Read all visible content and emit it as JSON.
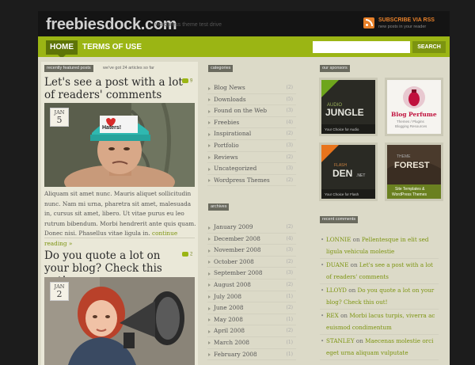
{
  "header": {
    "logo": "freebiesdock.com",
    "tagline": "wordpress theme test drive",
    "rss_title": "SUBSCRIBE VIA RSS",
    "rss_sub": "new posts in your reader"
  },
  "nav": {
    "home": "HOME",
    "terms": "TERMS OF USE",
    "search_placeholder": "",
    "search_button": "SEARCH"
  },
  "main": {
    "featured_badge": "recently featured posts",
    "articles_note": "we've got 24 articles so far",
    "posts": [
      {
        "title": "Let's see a post with a lot of readers' comments",
        "comments": "9",
        "month": "JAN",
        "day": "5",
        "hat_text": "Haters!",
        "excerpt": "Aliquam sit amet nunc. Mauris aliquet sollicitudin nunc. Nam mi urna, pharetra sit amet, malesuada in, cursus sit amet, libero. Ut vitae purus eu leo rutrum bibendum. Morbi hendrerit ante quis quam. Donec nisi. Phasellus vitae ligula in.",
        "continue": "continue reading »"
      },
      {
        "title": "Do you quote a lot on your blog? Check this out!",
        "comments": "2",
        "month": "JAN",
        "day": "2"
      }
    ]
  },
  "categories": {
    "badge": "categories",
    "items": [
      {
        "label": "Blog News",
        "count": "(2)"
      },
      {
        "label": "Downloads",
        "count": "(5)"
      },
      {
        "label": "Found on the Web",
        "count": "(3)"
      },
      {
        "label": "Freebies",
        "count": "(4)"
      },
      {
        "label": "Inspirational",
        "count": "(2)"
      },
      {
        "label": "Portfolio",
        "count": "(3)"
      },
      {
        "label": "Reviews",
        "count": "(2)"
      },
      {
        "label": "Uncategorized",
        "count": "(3)"
      },
      {
        "label": "Wordpress Themes",
        "count": "(2)"
      }
    ]
  },
  "archives": {
    "badge": "archives",
    "items": [
      {
        "label": "January 2009",
        "count": "(2)"
      },
      {
        "label": "December 2008",
        "count": "(4)"
      },
      {
        "label": "November 2008",
        "count": "(3)"
      },
      {
        "label": "October 2008",
        "count": "(2)"
      },
      {
        "label": "September 2008",
        "count": "(3)"
      },
      {
        "label": "August 2008",
        "count": "(2)"
      },
      {
        "label": "July 2008",
        "count": "(1)"
      },
      {
        "label": "June 2008",
        "count": "(2)"
      },
      {
        "label": "May 2008",
        "count": "(1)"
      },
      {
        "label": "April 2008",
        "count": "(2)"
      },
      {
        "label": "March 2008",
        "count": "(1)"
      },
      {
        "label": "February 2008",
        "count": "(1)"
      }
    ]
  },
  "sponsors": {
    "badge": "our sponsors",
    "items": [
      {
        "line1": "AUDIO",
        "line2": "JUNGLE",
        "tag": "Your Choice for Audio"
      },
      {
        "line1": "Blog Perfume",
        "line2": "Themes / Plugins",
        "tag": "Blogging Resources"
      },
      {
        "line1": "FLASH",
        "line2": "DEN",
        "line3": ".NET",
        "tag": "Your Choice for Flash"
      },
      {
        "line1": "THEME",
        "line2": "FOREST",
        "line3": "Site Templates &",
        "tag": "WordPress Themes"
      }
    ]
  },
  "recent_comments": {
    "badge": "recent comments",
    "items": [
      {
        "author": "LONNIE",
        "on": "on",
        "text": "Pellentesque in elit sed ligula vehicula molestie"
      },
      {
        "author": "DUANE",
        "on": "on",
        "text": "Let's see a post with a lot of readers' comments"
      },
      {
        "author": "LLOYD",
        "on": "on",
        "text": "Do you quote a lot on your blog? Check this out!"
      },
      {
        "author": "REX",
        "on": "on",
        "text": "Morbi lacus turpis, viverra ac euismod condimentum"
      },
      {
        "author": "STANLEY",
        "on": "on",
        "text": "Maecenas molestie orci eget urna aliquam vulputate"
      }
    ]
  },
  "colors": {
    "accent": "#9bb514",
    "accent_dark": "#5e7408",
    "rss": "#e8812a",
    "background": "#1c1c1c"
  }
}
